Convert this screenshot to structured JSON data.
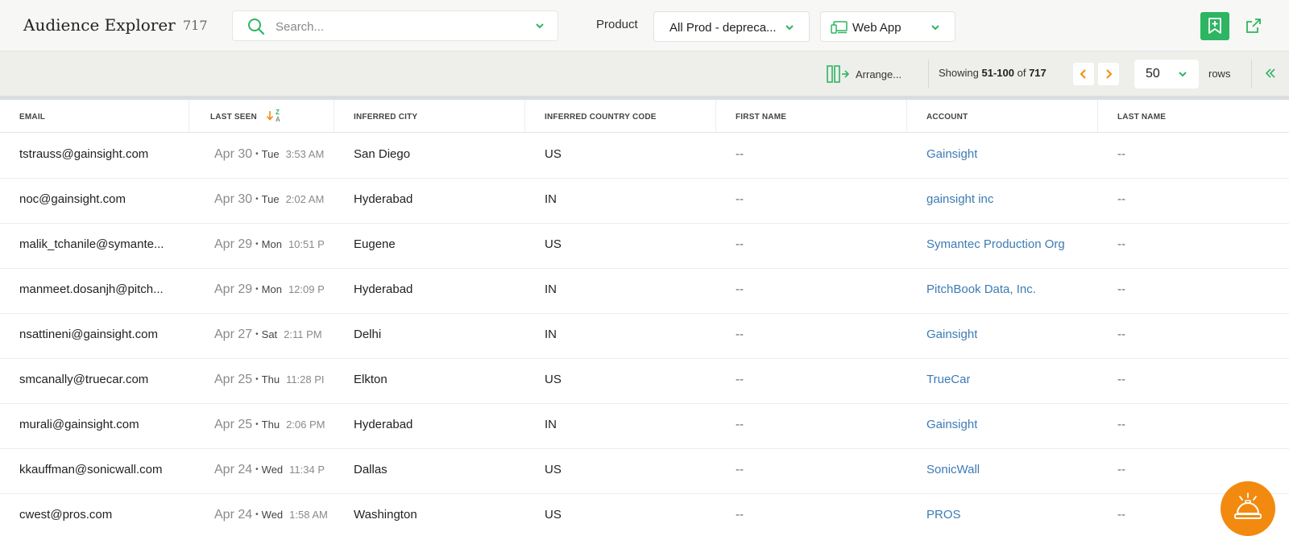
{
  "header": {
    "title": "Audience Explorer",
    "count": "717",
    "search_placeholder": "Search...",
    "product_label": "Product",
    "product_value": "All Prod - depreca...",
    "app_value": "Web App"
  },
  "toolbar": {
    "arrange_label": "Arrange...",
    "showing_prefix": "Showing",
    "showing_range": "51-100",
    "showing_of": "of",
    "showing_total": "717",
    "rows_value": "50",
    "rows_label": "rows"
  },
  "columns": {
    "email": "EMAIL",
    "last_seen": "LAST SEEN",
    "city": "INFERRED CITY",
    "country": "INFERRED COUNTRY CODE",
    "first_name": "FIRST NAME",
    "account": "ACCOUNT",
    "last_name": "LAST NAME"
  },
  "sort": {
    "top": "Z",
    "bottom": "A"
  },
  "rows": [
    {
      "email": "tstrauss@gainsight.com",
      "date": "Apr 30",
      "dow": "Tue",
      "time": "3:53 AM",
      "city": "San Diego",
      "country": "US",
      "first": "--",
      "account": "Gainsight",
      "last": "--"
    },
    {
      "email": "noc@gainsight.com",
      "date": "Apr 30",
      "dow": "Tue",
      "time": "2:02 AM",
      "city": "Hyderabad",
      "country": "IN",
      "first": "--",
      "account": "gainsight inc",
      "last": "--"
    },
    {
      "email": "malik_tchanile@symante...",
      "date": "Apr 29",
      "dow": "Mon",
      "time": "10:51 P",
      "city": "Eugene",
      "country": "US",
      "first": "--",
      "account": "Symantec Production Org",
      "last": "--"
    },
    {
      "email": "manmeet.dosanjh@pitch...",
      "date": "Apr 29",
      "dow": "Mon",
      "time": "12:09 P",
      "city": "Hyderabad",
      "country": "IN",
      "first": "--",
      "account": "PitchBook Data, Inc.",
      "last": "--"
    },
    {
      "email": "nsattineni@gainsight.com",
      "date": "Apr 27",
      "dow": "Sat",
      "time": "2:11 PM",
      "city": "Delhi",
      "country": "IN",
      "first": "--",
      "account": "Gainsight",
      "last": "--"
    },
    {
      "email": "smcanally@truecar.com",
      "date": "Apr 25",
      "dow": "Thu",
      "time": "11:28 PI",
      "city": "Elkton",
      "country": "US",
      "first": "--",
      "account": "TrueCar",
      "last": "--"
    },
    {
      "email": "murali@gainsight.com",
      "date": "Apr 25",
      "dow": "Thu",
      "time": "2:06 PM",
      "city": "Hyderabad",
      "country": "IN",
      "first": "--",
      "account": "Gainsight",
      "last": "--"
    },
    {
      "email": "kkauffman@sonicwall.com",
      "date": "Apr 24",
      "dow": "Wed",
      "time": "11:34 P",
      "city": "Dallas",
      "country": "US",
      "first": "--",
      "account": "SonicWall",
      "last": "--"
    },
    {
      "email": "cwest@pros.com",
      "date": "Apr 24",
      "dow": "Wed",
      "time": "1:58 AM",
      "city": "Washington",
      "country": "US",
      "first": "--",
      "account": "PROS",
      "last": "--"
    }
  ],
  "colors": {
    "brand_green": "#2db562",
    "accent_orange": "#f28a0f",
    "link_blue": "#3d7bb5"
  },
  "icons": [
    "search-icon",
    "chevron-down-icon",
    "device-icon",
    "bookmark-add-icon",
    "external-link-icon",
    "arrange-columns-icon",
    "chevron-left-icon",
    "chevron-right-icon",
    "double-chevron-left-icon",
    "sort-icon",
    "service-bell-icon"
  ]
}
